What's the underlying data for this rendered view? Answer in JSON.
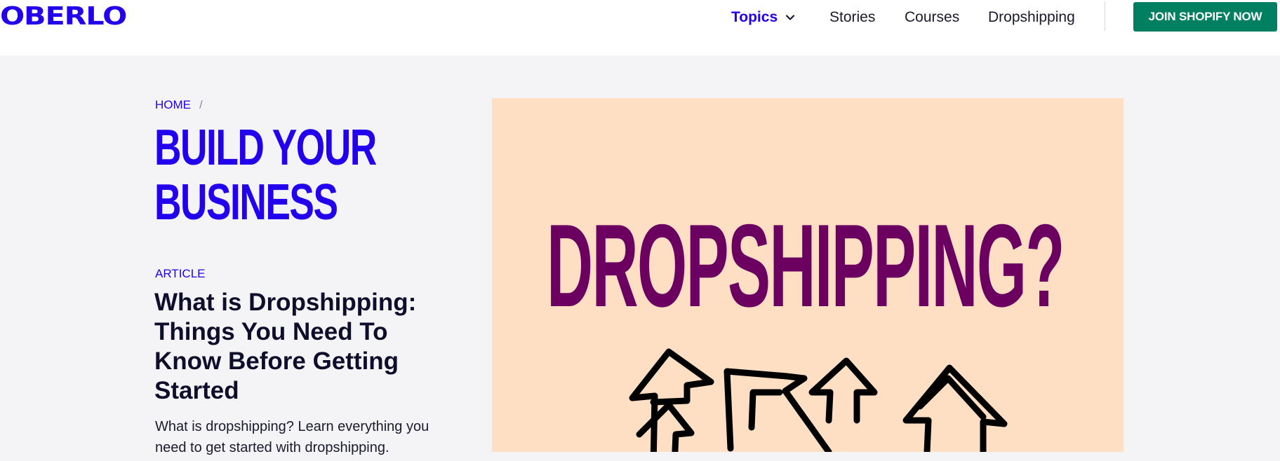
{
  "header": {
    "logo": "OBERLO",
    "nav": {
      "topics": "Topics",
      "stories": "Stories",
      "courses": "Courses",
      "dropshipping": "Dropshipping"
    },
    "cta": "JOIN SHOPIFY NOW"
  },
  "breadcrumb": {
    "home": "HOME",
    "separator": "/"
  },
  "category": {
    "title_line1": "BUILD YOUR",
    "title_line2": "BUSINESS"
  },
  "article": {
    "label": "ARTICLE",
    "title": "What is Dropshipping: Things You Need To Know Before Getting Started",
    "description": "What is dropshipping? Learn everything you need to get started with dropshipping."
  },
  "hero": {
    "text": "DROPSHIPPING?",
    "background_color": "#ffdfc4",
    "text_color": "#6b0060"
  },
  "colors": {
    "brand": "#2200ee",
    "cta": "#008060",
    "page_background": "#f4f4f6"
  }
}
